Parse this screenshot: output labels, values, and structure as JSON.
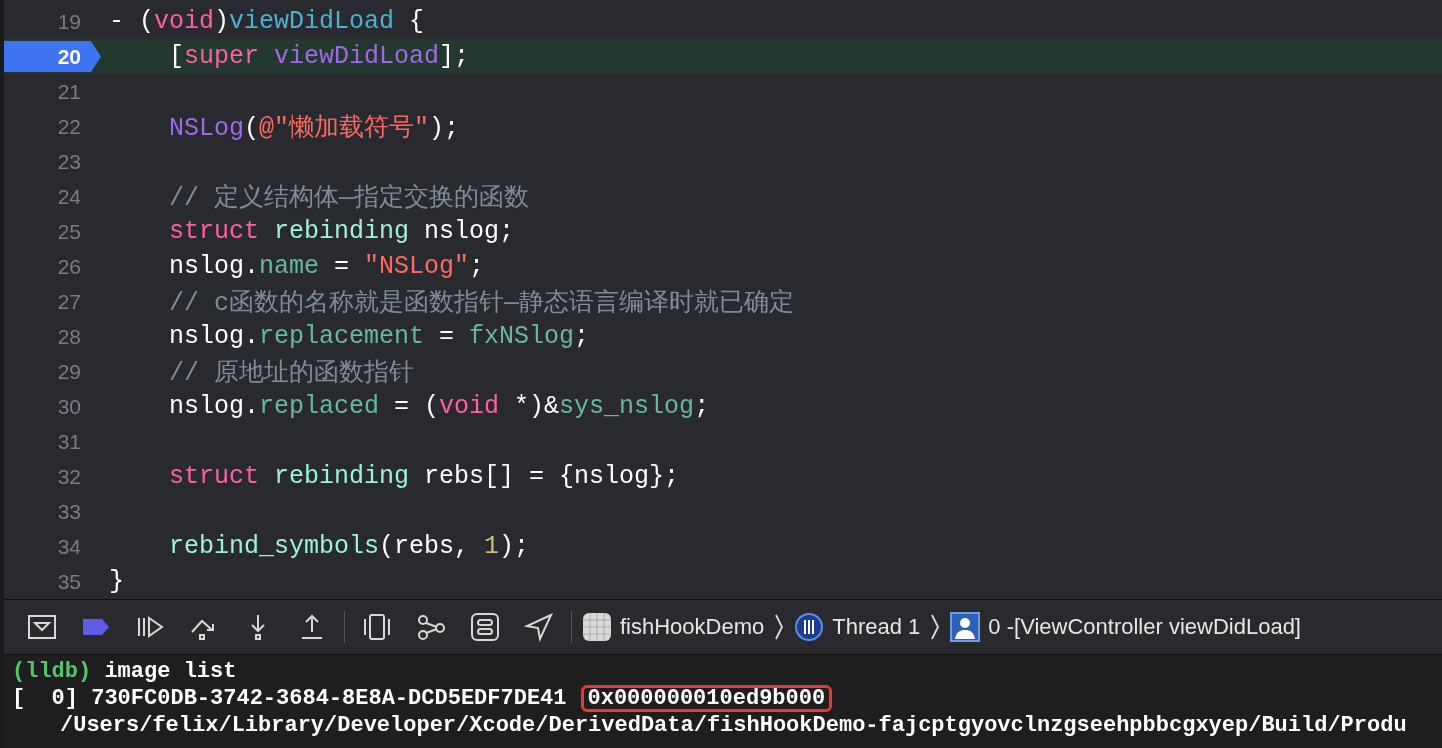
{
  "editor": {
    "lines": [
      {
        "number": "19",
        "breakpoint": false,
        "current": false,
        "indented": false,
        "tokens": [
          {
            "kind": "plain",
            "text": "- ("
          },
          {
            "kind": "keyword",
            "text": "void"
          },
          {
            "kind": "plain",
            "text": ")"
          },
          {
            "kind": "decl",
            "text": "viewDidLoad"
          },
          {
            "kind": "plain",
            "text": " {"
          }
        ]
      },
      {
        "number": "20",
        "breakpoint": true,
        "current": true,
        "indented": true,
        "tokens": [
          {
            "kind": "plain",
            "text": "["
          },
          {
            "kind": "keyword",
            "text": "super "
          },
          {
            "kind": "method",
            "text": "viewDidLoad"
          },
          {
            "kind": "plain",
            "text": "];"
          }
        ]
      },
      {
        "number": "21",
        "breakpoint": false,
        "current": false
      },
      {
        "number": "22",
        "breakpoint": false,
        "current": false,
        "indented": true,
        "tokens": [
          {
            "kind": "method",
            "text": "NSLog"
          },
          {
            "kind": "plain",
            "text": "("
          },
          {
            "kind": "string",
            "text": "@\"懒加载符号\""
          },
          {
            "kind": "plain",
            "text": ");"
          }
        ]
      },
      {
        "number": "23",
        "breakpoint": false,
        "current": false
      },
      {
        "number": "24",
        "breakpoint": false,
        "current": false,
        "indented": true,
        "tokens": [
          {
            "kind": "comment",
            "text": "// 定义结构体—指定交换的函数"
          }
        ]
      },
      {
        "number": "25",
        "breakpoint": false,
        "current": false,
        "indented": true,
        "tokens": [
          {
            "kind": "keyword",
            "text": "struct "
          },
          {
            "kind": "type",
            "text": "rebinding"
          },
          {
            "kind": "plain",
            "text": " nslog;"
          }
        ]
      },
      {
        "number": "26",
        "breakpoint": false,
        "current": false,
        "indented": true,
        "tokens": [
          {
            "kind": "plain",
            "text": "nslog."
          },
          {
            "kind": "property",
            "text": "name"
          },
          {
            "kind": "plain",
            "text": " = "
          },
          {
            "kind": "string",
            "text": "\"NSLog\""
          },
          {
            "kind": "plain",
            "text": ";"
          }
        ]
      },
      {
        "number": "27",
        "breakpoint": false,
        "current": false,
        "indented": true,
        "tokens": [
          {
            "kind": "comment",
            "text": "// c函数的名称就是函数指针—静态语言编译时就已确定"
          }
        ]
      },
      {
        "number": "28",
        "breakpoint": false,
        "current": false,
        "indented": true,
        "tokens": [
          {
            "kind": "plain",
            "text": "nslog."
          },
          {
            "kind": "property",
            "text": "replacement"
          },
          {
            "kind": "plain",
            "text": " = "
          },
          {
            "kind": "property",
            "text": "fxNSlog"
          },
          {
            "kind": "plain",
            "text": ";"
          }
        ]
      },
      {
        "number": "29",
        "breakpoint": false,
        "current": false,
        "indented": true,
        "tokens": [
          {
            "kind": "comment",
            "text": "// 原地址的函数指针"
          }
        ]
      },
      {
        "number": "30",
        "breakpoint": false,
        "current": false,
        "indented": true,
        "tokens": [
          {
            "kind": "plain",
            "text": "nslog."
          },
          {
            "kind": "property",
            "text": "replaced"
          },
          {
            "kind": "plain",
            "text": " = ("
          },
          {
            "kind": "keyword",
            "text": "void"
          },
          {
            "kind": "plain",
            "text": " *)&"
          },
          {
            "kind": "property",
            "text": "sys_nslog"
          },
          {
            "kind": "plain",
            "text": ";"
          }
        ]
      },
      {
        "number": "31",
        "breakpoint": false,
        "current": false
      },
      {
        "number": "32",
        "breakpoint": false,
        "current": false,
        "indented": true,
        "tokens": [
          {
            "kind": "keyword",
            "text": "struct "
          },
          {
            "kind": "type",
            "text": "rebinding"
          },
          {
            "kind": "plain",
            "text": " rebs[] = {nslog};"
          }
        ]
      },
      {
        "number": "33",
        "breakpoint": false,
        "current": false
      },
      {
        "number": "34",
        "breakpoint": false,
        "current": false,
        "indented": true,
        "tokens": [
          {
            "kind": "type",
            "text": "rebind_symbols"
          },
          {
            "kind": "plain",
            "text": "(rebs, "
          },
          {
            "kind": "number",
            "text": "1"
          },
          {
            "kind": "plain",
            "text": ");"
          }
        ]
      },
      {
        "number": "35",
        "breakpoint": false,
        "current": false,
        "indented": false,
        "tokens": [
          {
            "kind": "plain",
            "text": "}"
          }
        ]
      }
    ]
  },
  "debug_bar": {
    "breadcrumb": [
      {
        "kind": "app",
        "label": "fishHookDemo"
      },
      {
        "kind": "thread",
        "label": "Thread 1"
      },
      {
        "kind": "frame",
        "label": "0 -[ViewController viewDidLoad]"
      }
    ]
  },
  "console": {
    "lines": [
      {
        "kind": "command",
        "prompt": "(lldb)",
        "text": "image list"
      },
      {
        "kind": "image",
        "index": "[  0]",
        "uuid": "730FC0DB-3742-3684-8E8A-DCD5EDF7DE41",
        "address": "0x000000010ed9b000",
        "highlighted": true
      },
      {
        "kind": "path",
        "text": "/Users/felix/Library/Developer/Xcode/DerivedData/fishHookDemo-fajcptgyovclnzgseehpbbcgxyep/Build/Produ"
      }
    ]
  }
}
